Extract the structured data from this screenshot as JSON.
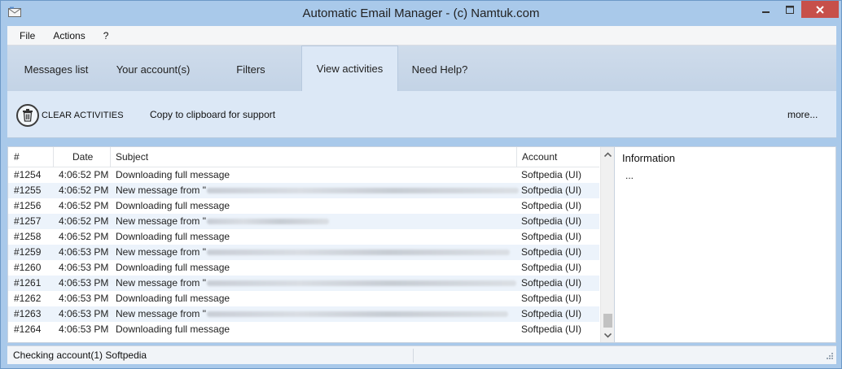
{
  "window": {
    "title": "Automatic Email Manager - (c) Namtuk.com",
    "app_icon": "envelope-icon",
    "controls": [
      "minimize-icon",
      "maximize-icon",
      "close-icon"
    ]
  },
  "menu": {
    "items": [
      {
        "label": "File"
      },
      {
        "label": "Actions"
      },
      {
        "label": "?"
      }
    ]
  },
  "tabs": [
    {
      "label": "Messages list",
      "active": false
    },
    {
      "label": "Your account(s)",
      "active": false
    },
    {
      "label": "Filters",
      "active": false
    },
    {
      "label": "View activities",
      "active": true
    },
    {
      "label": "Need Help?",
      "active": false
    }
  ],
  "toolbar": {
    "clear_label": "CLEAR ACTIVITIES",
    "clear_icon": "trash-icon",
    "copy_label": "Copy to clipboard for support",
    "more_label": "more..."
  },
  "grid": {
    "columns": {
      "num": "#",
      "date": "Date",
      "subject": "Subject",
      "account": "Account"
    },
    "rows": [
      {
        "num": "#1254",
        "date": "4:06:52 PM",
        "subject": "Downloading full message",
        "redacted": false,
        "account": "Softpedia (UI)"
      },
      {
        "num": "#1255",
        "date": "4:06:52 PM",
        "subject": "New message from \"",
        "redacted": true,
        "account": "Softpedia (UI)"
      },
      {
        "num": "#1256",
        "date": "4:06:52 PM",
        "subject": "Downloading full message",
        "redacted": false,
        "account": "Softpedia (UI)"
      },
      {
        "num": "#1257",
        "date": "4:06:52 PM",
        "subject": "New message from \"",
        "redacted": true,
        "account": "Softpedia (UI)"
      },
      {
        "num": "#1258",
        "date": "4:06:52 PM",
        "subject": "Downloading full message",
        "redacted": false,
        "account": "Softpedia (UI)"
      },
      {
        "num": "#1259",
        "date": "4:06:53 PM",
        "subject": "New message from \"",
        "redacted": true,
        "account": "Softpedia (UI)"
      },
      {
        "num": "#1260",
        "date": "4:06:53 PM",
        "subject": "Downloading full message",
        "redacted": false,
        "account": "Softpedia (UI)"
      },
      {
        "num": "#1261",
        "date": "4:06:53 PM",
        "subject": "New message from \"",
        "redacted": true,
        "account": "Softpedia (UI)"
      },
      {
        "num": "#1262",
        "date": "4:06:53 PM",
        "subject": "Downloading full message",
        "redacted": false,
        "account": "Softpedia (UI)"
      },
      {
        "num": "#1263",
        "date": "4:06:53 PM",
        "subject": "New message from \"",
        "redacted": true,
        "account": "Softpedia (UI)"
      },
      {
        "num": "#1264",
        "date": "4:06:53 PM",
        "subject": "Downloading full message",
        "redacted": false,
        "account": "Softpedia (UI)"
      }
    ]
  },
  "info": {
    "title": "Information",
    "body": "..."
  },
  "status": {
    "text": "Checking account(1) Softpedia"
  },
  "colors": {
    "frame": "#a9c9ea",
    "toolbar": "#dce8f6",
    "row_alt": "#ecf3fb",
    "close_button": "#c7504a"
  }
}
